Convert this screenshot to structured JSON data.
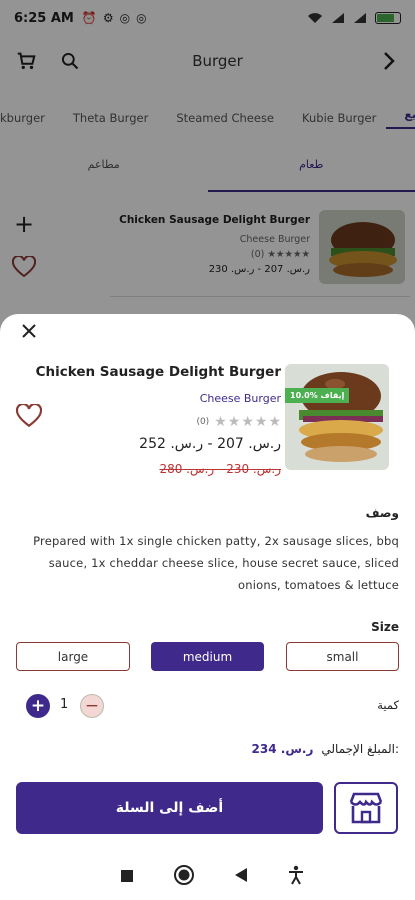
{
  "status_bar": {
    "time": "6:25 AM"
  },
  "top_bar": {
    "title": "Burger"
  },
  "categories": [
    "kburger",
    "Theta Burger",
    "Steamed Cheese",
    "Kubie Burger",
    "الجميع"
  ],
  "sub_tabs": [
    "مطاعم",
    "طعام"
  ],
  "background_item": {
    "name": "Chicken Sausage Delight Burger",
    "category": "Cheese Burger",
    "rating_count": "(0)",
    "price": "ر.س. 207 - ر.س. 230"
  },
  "product": {
    "name": "Chicken Sausage Delight Burger",
    "category": "Cheese Burger",
    "rating_count": "(0)",
    "rating": 0,
    "rating_max": 5,
    "price": "ر.س. 207 - ر.س. 252",
    "old_price": "ر.س. 230 - ر.س. 280",
    "discount_badge": "10.0% إيقاف"
  },
  "description": {
    "title": "وصف",
    "text": "Prepared with 1x single chicken patty, 2x sausage slices, bbq sauce, 1x cheddar cheese slice, house secret sauce, sliced onions, tomatoes & lettuce"
  },
  "size": {
    "title": "Size",
    "options": [
      "large",
      "medium",
      "small"
    ],
    "selected": "medium"
  },
  "quantity": {
    "label": "كمية",
    "value": "1"
  },
  "total": {
    "label": "المبلغ الإجمالي:",
    "value": "ر.س. 234"
  },
  "actions": {
    "add_to_cart": "أضف إلى السلة"
  },
  "colors": {
    "primary": "#3f2a8c",
    "accent_border": "#8a3a34",
    "discount": "#4caf50",
    "old_price": "#bb3333"
  }
}
